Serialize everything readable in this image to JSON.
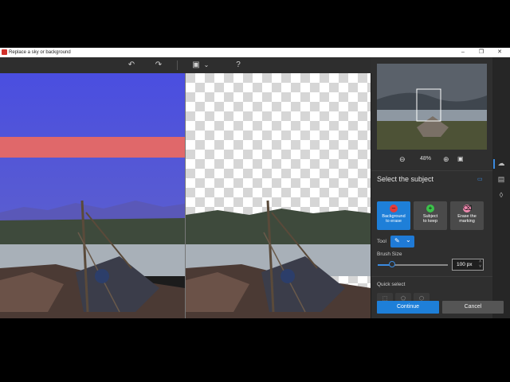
{
  "window": {
    "title": "Replace a sky or background",
    "controls": {
      "minimize": "–",
      "restore": "❐",
      "close": "✕"
    }
  },
  "toolbar": {
    "undo_icon": "↶",
    "redo_icon": "↷",
    "view_icon": "▣",
    "view_chevron": "⌄",
    "help_label": "?"
  },
  "navigator": {
    "zoom_out_icon": "⊖",
    "zoom_level": "48%",
    "zoom_in_icon": "⊕",
    "fit_icon": "▣"
  },
  "panel": {
    "title": "Select the subject",
    "modes": [
      {
        "label_line1": "Background",
        "label_line2": "to erase",
        "symbol": "–",
        "color": "#e23b3b",
        "active": true
      },
      {
        "label_line1": "Subject",
        "label_line2": "to keep",
        "symbol": "+",
        "color": "#3bc24a",
        "active": false
      },
      {
        "label_line1": "Erase the",
        "label_line2": "marking",
        "symbol": "⌫",
        "color": "#f08ab0",
        "active": false
      }
    ],
    "tool_label": "Tool",
    "tool_icon": "✎",
    "tool_chevron": "⌄",
    "brush_label": "Brush Size",
    "brush_value": "100 px",
    "brush_fraction": 0.2,
    "quick_select_label": "Quick select",
    "quick_select_icons": [
      "⬚",
      "⬠",
      "⬡"
    ]
  },
  "footer": {
    "continue_label": "Continue",
    "cancel_label": "Cancel"
  },
  "colors": {
    "accent": "#1e7fd8",
    "erase_marking": "#e0686a",
    "sky_overlay": "#4a4fd8"
  }
}
